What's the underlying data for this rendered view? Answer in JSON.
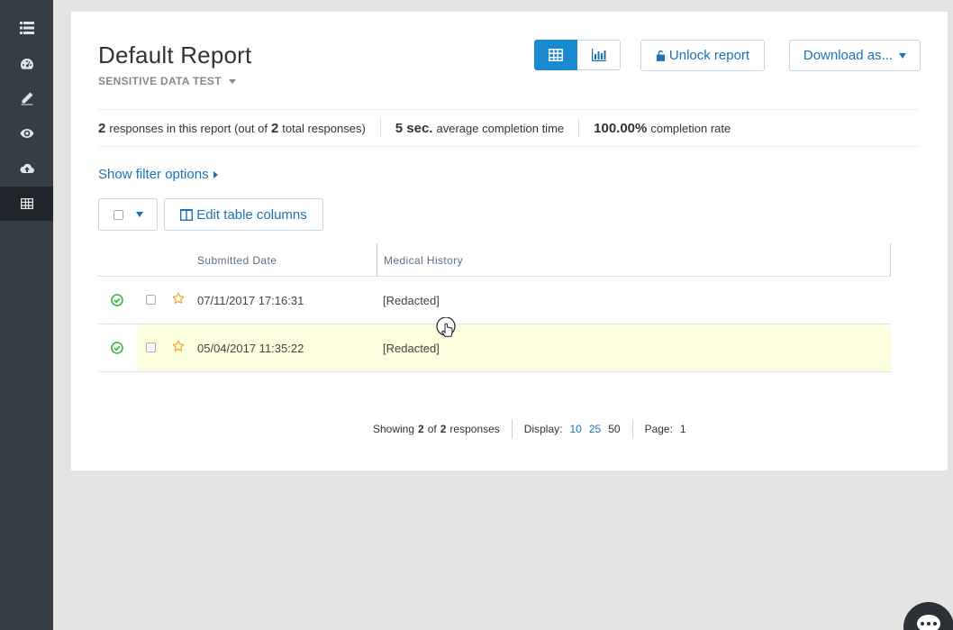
{
  "sidebar": {
    "items": [
      {
        "icon": "list-icon"
      },
      {
        "icon": "dashboard-icon"
      },
      {
        "icon": "pencil-icon"
      },
      {
        "icon": "eye-icon"
      },
      {
        "icon": "cloud-upload-icon"
      },
      {
        "icon": "table-icon",
        "active": true
      }
    ]
  },
  "header": {
    "title": "Default Report",
    "subtitle": "SENSITIVE DATA TEST",
    "unlock_label": "Unlock report",
    "download_label": "Download as..."
  },
  "stats": {
    "responses_count": "2",
    "responses_text_a": "responses in this report (out of",
    "total_count": "2",
    "responses_text_b": "total responses)",
    "avg_time": "5 sec.",
    "avg_time_label": "average completion time",
    "completion_rate": "100.00%",
    "completion_label": "completion rate"
  },
  "toolbar": {
    "filter_label": "Show filter options",
    "edit_columns_label": "Edit table columns"
  },
  "table": {
    "headers": {
      "date": "Submitted Date",
      "medical": "Medical History"
    },
    "rows": [
      {
        "date": "07/11/2017 17:16:31",
        "medical": "[Redacted]"
      },
      {
        "date": "05/04/2017 11:35:22",
        "medical": "[Redacted]"
      }
    ]
  },
  "pager": {
    "showing": "Showing",
    "shown": "2",
    "of": "of",
    "total": "2",
    "responses": "responses",
    "display_label": "Display:",
    "display_options": [
      "10",
      "25",
      "50"
    ],
    "page_label": "Page:",
    "page": "1"
  },
  "colors": {
    "accent": "#1a8ad0",
    "link": "#1a73b8",
    "sidebar": "#353d45",
    "highlight_row": "#fdfde0",
    "success": "#3cb34a",
    "star": "#f0a830"
  }
}
